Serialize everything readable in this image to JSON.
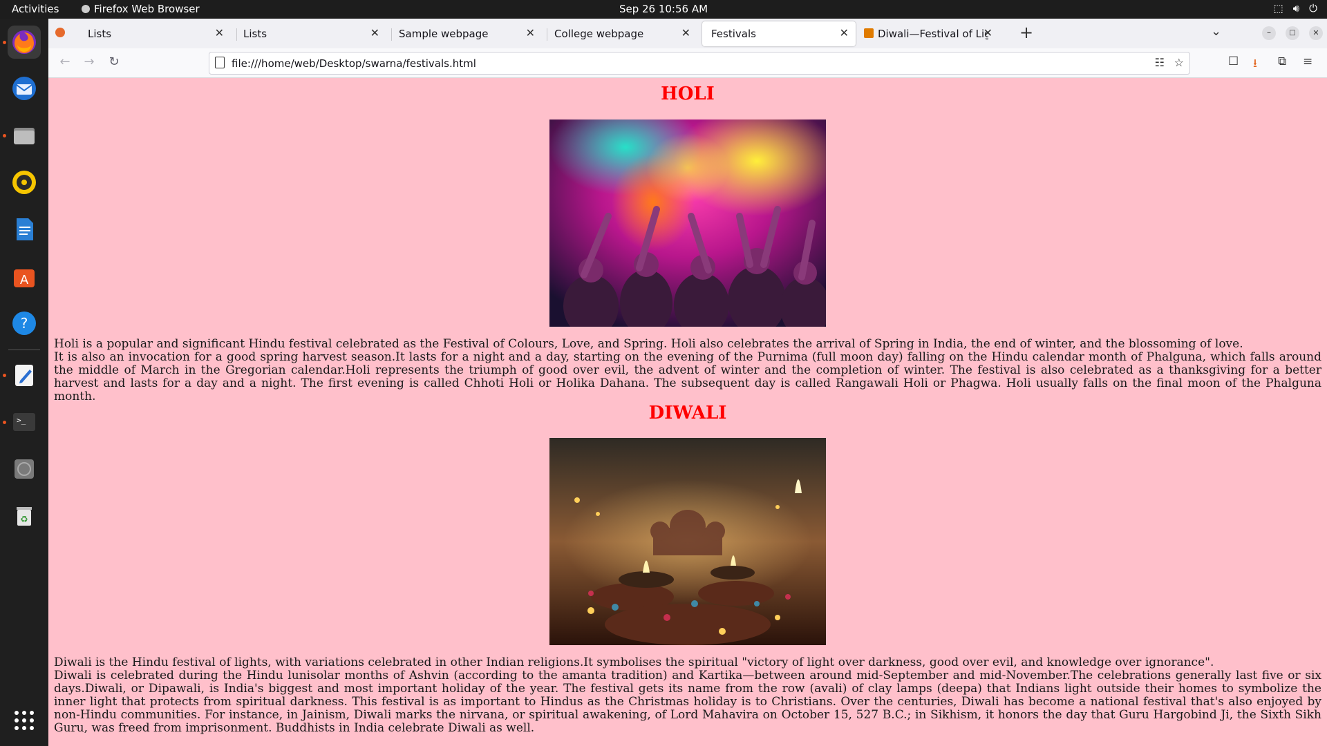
{
  "topbar": {
    "activities": "Activities",
    "app_name": "Firefox Web Browser",
    "clock": "Sep 26  10:56 AM"
  },
  "dock": {
    "items": [
      "firefox-icon",
      "thunderbird-icon",
      "files-icon",
      "rhythmbox-icon",
      "writer-icon",
      "app-center-icon",
      "help-icon",
      "text-editor-icon",
      "terminal-icon",
      "disc-icon",
      "trash-icon",
      "app-grid-icon"
    ]
  },
  "browser": {
    "tabs": [
      {
        "label": "Lists"
      },
      {
        "label": "Lists"
      },
      {
        "label": "Sample webpage"
      },
      {
        "label": "College webpage"
      },
      {
        "label": "Festivals"
      },
      {
        "label": "Diwali—Festival of Lights"
      }
    ],
    "new_tab": "+",
    "url": "file:///home/web/Desktop/swarna/festivals.html"
  },
  "page": {
    "holi": {
      "title": "HOLI",
      "p1": "Holi is a popular and significant Hindu festival celebrated as the Festival of Colours, Love, and Spring. Holi also celebrates the arrival of Spring in India, the end of winter, and the blossoming of love.",
      "p2": "It is also an invocation for a good spring harvest season.It lasts for a night and a day, starting on the evening of the Purnima (full moon day) falling on the Hindu calendar month of Phalguna, which falls around the middle of March in the Gregorian calendar.Holi represents the triumph of good over evil, the advent of winter and the completion of winter. The festival is also celebrated as a thanksgiving for a better harvest and lasts for a day and a night. The first evening is called Chhoti Holi or Holika Dahana. The subsequent day is called Rangawali Holi or Phagwa. Holi usually falls on the final moon of the Phalguna month."
    },
    "diwali": {
      "title": "DIWALI",
      "p1": "Diwali is the Hindu festival of lights, with variations celebrated in other Indian religions.It symbolises the spiritual \"victory of light over darkness, good over evil, and knowledge over ignorance\".",
      "p2": "Diwali is celebrated during the Hindu lunisolar months of Ashvin (according to the amanta tradition) and Kartika—between around mid-September and mid-November.The celebrations generally last five or six days.Diwali, or Dipawali, is India's biggest and most important holiday of the year. The festival gets its name from the row (avali) of clay lamps (deepa) that Indians light outside their homes to symbolize the inner light that protects from spiritual darkness. This festival is as important to Hindus as the Christmas holiday is to Christians. Over the centuries, Diwali has become a national festival that's also enjoyed by non-Hindu communities. For instance, in Jainism, Diwali marks the nirvana, or spiritual awakening, of Lord Mahavira on October 15, 527 B.C.; in Sikhism, it honors the day that Guru Hargobind Ji, the Sixth Sikh Guru, was freed from imprisonment. Buddhists in India celebrate Diwali as well."
    }
  },
  "colors": {
    "page_bg": "#ffc0cb",
    "heading": "#ff0000"
  }
}
